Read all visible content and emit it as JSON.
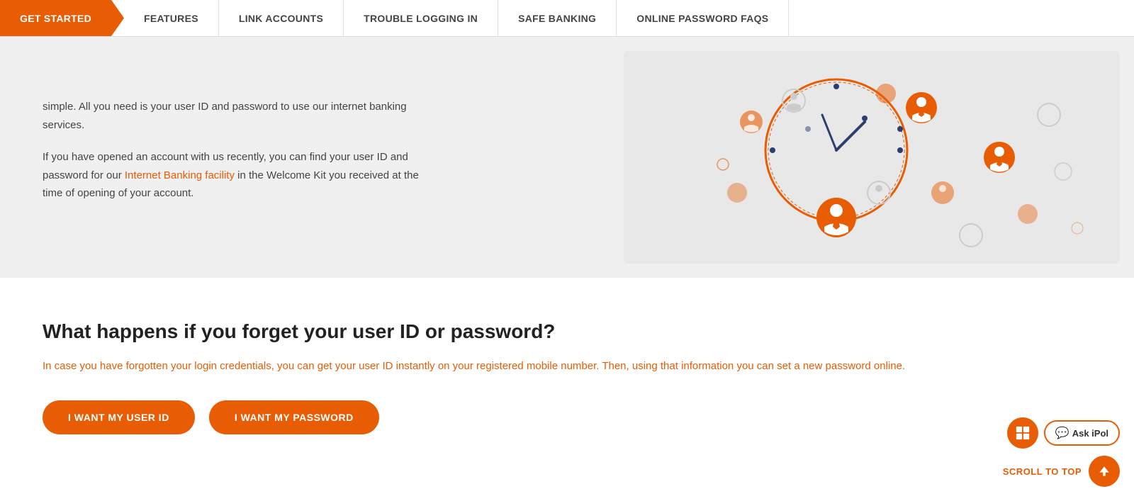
{
  "nav": {
    "items": [
      {
        "label": "GET STARTED",
        "active": true
      },
      {
        "label": "FEATURES",
        "active": false
      },
      {
        "label": "LINK ACCOUNTS",
        "active": false
      },
      {
        "label": "TROUBLE LOGGING IN",
        "active": false
      },
      {
        "label": "SAFE BANKING",
        "active": false
      },
      {
        "label": "ONLINE PASSWORD FAQS",
        "active": false
      }
    ]
  },
  "hero": {
    "paragraph1": "simple. All you need is your user ID and password to use our internet banking services.",
    "paragraph2_prefix": "If you have opened an account with us recently, you can find your user ID and password for our ",
    "paragraph2_link": "Internet Banking facility",
    "paragraph2_suffix": " in the Welcome Kit you received at the time of opening of your account."
  },
  "main": {
    "title": "What happens if you forget your user ID or password?",
    "description": "In case you have forgotten your login credentials, you can get your user ID instantly on your registered mobile number. Then, using that information you can set a new password online.",
    "btn1": "I WANT MY USER ID",
    "btn2": "I WANT MY PASSWORD"
  },
  "widgets": {
    "ask_ipol_label": "Ask iPol",
    "scroll_top_label": "SCROLL TO TOP"
  },
  "colors": {
    "orange": "#e85d04",
    "text_dark": "#222",
    "text_muted": "#444"
  }
}
